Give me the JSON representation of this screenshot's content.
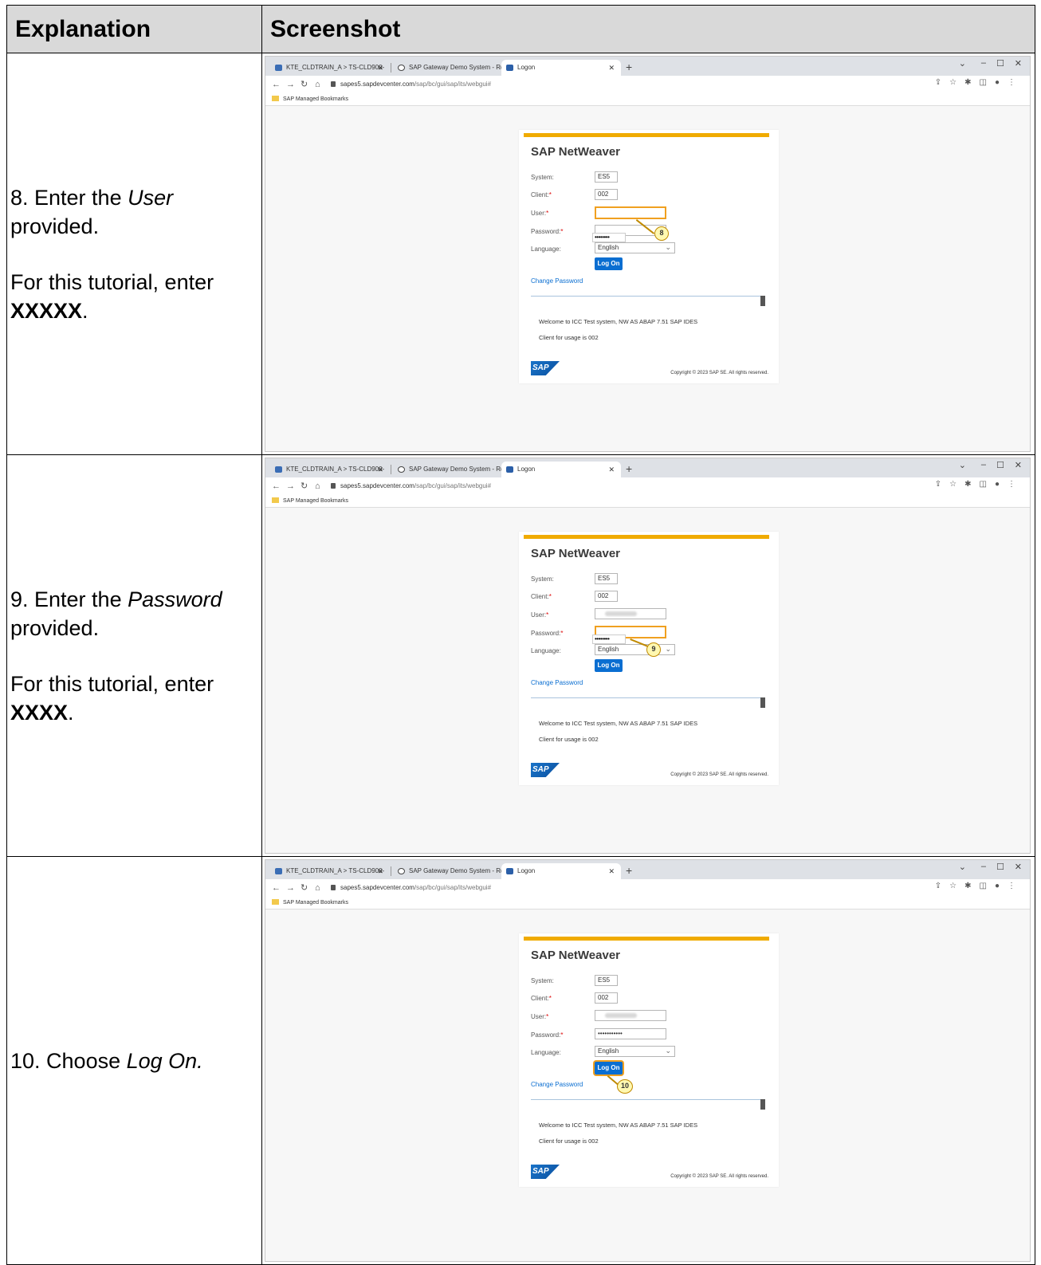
{
  "table": {
    "header_explanation": "Explanation",
    "header_screenshot": "Screenshot"
  },
  "steps": [
    {
      "num": "8. Enter the ",
      "emph": "User",
      "rest": "provided.",
      "hint_prefix": "For this tutorial, enter ",
      "hint_value": "XXXXX",
      "hint_suffix": ".",
      "callout": "8"
    },
    {
      "num": "9. Enter the ",
      "emph": "Password",
      "rest": "provided.",
      "hint_prefix": "For this tutorial, enter ",
      "hint_value": "XXXX",
      "hint_suffix": ".",
      "callout": "9"
    },
    {
      "num": "10. Choose ",
      "emph": "Log On.",
      "callout": "10"
    }
  ],
  "browser": {
    "tabs": [
      {
        "label": "KTE_CLDTRAIN_A > TS-CLD900-"
      },
      {
        "label": "SAP Gateway Demo System - Re"
      },
      {
        "label": "Logon"
      }
    ],
    "new_tab": "+",
    "url_host": "sapes5.sapdevcenter.com",
    "url_path": "/sap/bc/gui/sap/its/webgui#",
    "bookmark": "SAP Managed Bookmarks"
  },
  "logon": {
    "title": "SAP NetWeaver",
    "system_label": "System:",
    "system_value": "ES5",
    "client_label": "Client:",
    "client_value": "002",
    "user_label": "User:",
    "password_label": "Password:",
    "password_dots": "••••••••",
    "password_dots_filled": "•••••••••••",
    "language_label": "Language:",
    "language_value": "English",
    "logon_button": "Log On",
    "change_password": "Change Password",
    "welcome": "Welcome to ICC Test system, NW AS ABAP 7.51 SAP IDES",
    "client_usage": "Client for usage is 002",
    "logo": "SAP",
    "copyright": "Copyright © 2023 SAP SE. All rights reserved.",
    "required_mark": "*"
  },
  "colors": {
    "accent_bar": "#f0ab00",
    "highlight": "#f0a020",
    "button": "#0a6ed1"
  }
}
